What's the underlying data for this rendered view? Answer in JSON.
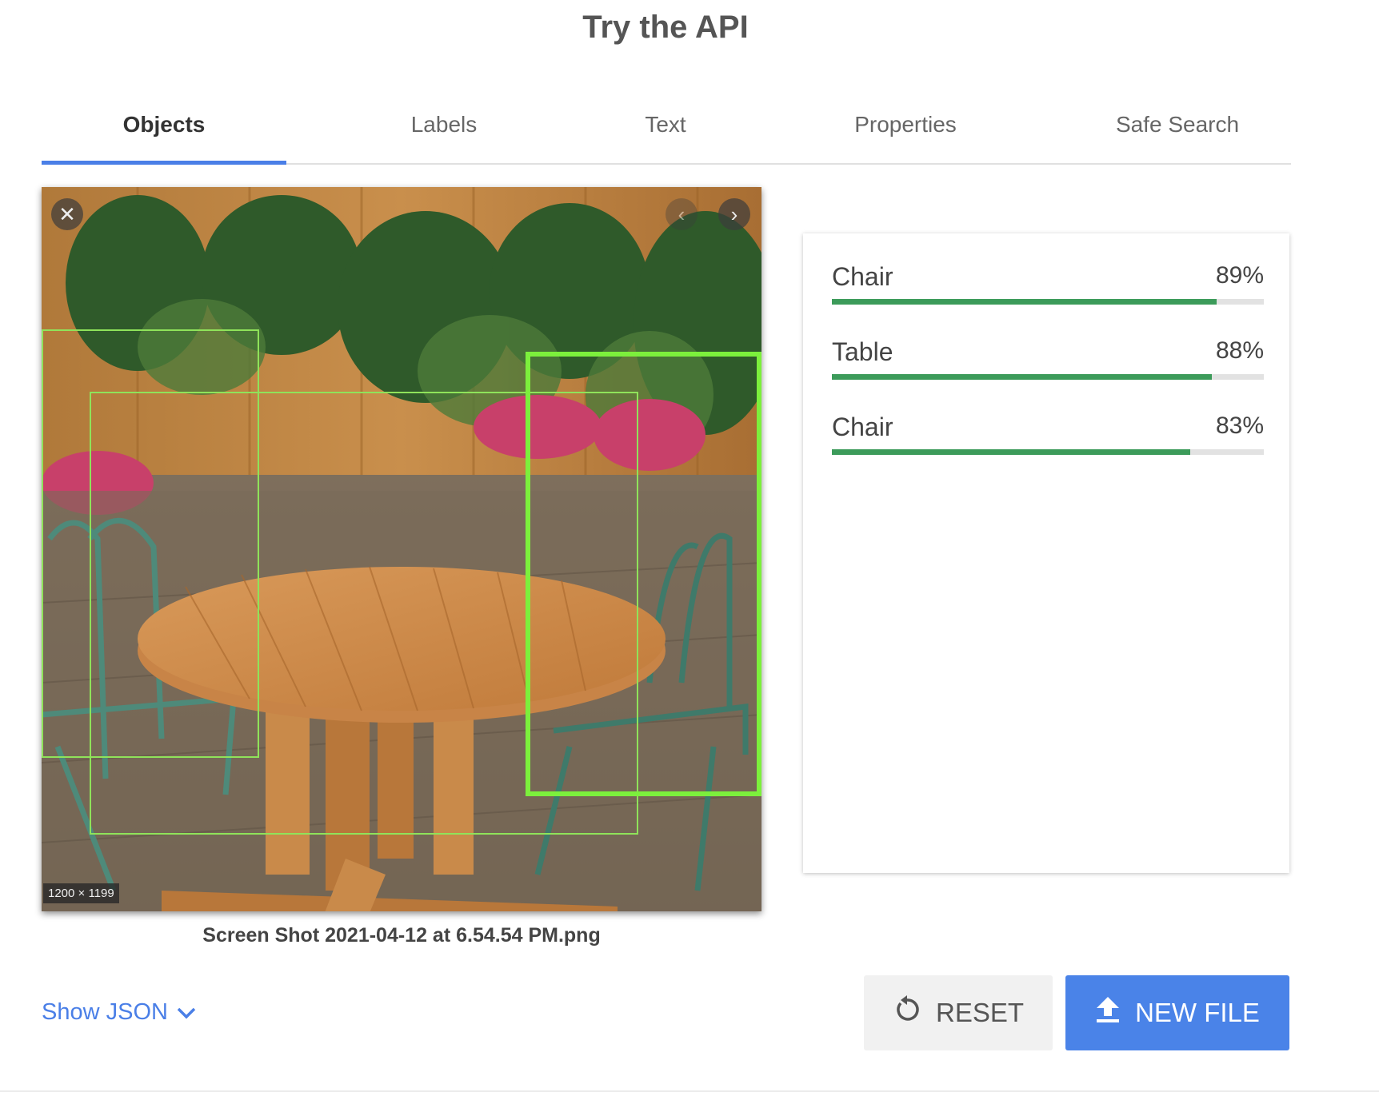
{
  "page": {
    "title": "Try the API"
  },
  "tabs": [
    {
      "label": "Objects",
      "active": true
    },
    {
      "label": "Labels",
      "active": false
    },
    {
      "label": "Text",
      "active": false
    },
    {
      "label": "Properties",
      "active": false
    },
    {
      "label": "Safe Search",
      "active": false
    }
  ],
  "image": {
    "dimensions": "1200 × 1199",
    "file_name": "Screen Shot 2021-04-12 at 6.54.54 PM.png"
  },
  "results": [
    {
      "label": "Chair",
      "score_text": "89%",
      "score": 0.89
    },
    {
      "label": "Table",
      "score_text": "88%",
      "score": 0.88
    },
    {
      "label": "Chair",
      "score_text": "83%",
      "score": 0.83
    }
  ],
  "footer": {
    "show_json_label": "Show JSON",
    "reset_label": "RESET",
    "new_file_label": "NEW FILE"
  },
  "colors": {
    "accent": "#4a7fe7",
    "score_bar": "#3c9b5a",
    "bbox": "#7cf03c"
  }
}
